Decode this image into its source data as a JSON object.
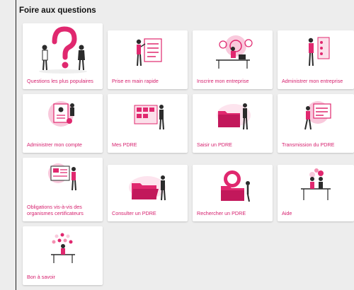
{
  "page": {
    "title": "Foire aux questions"
  },
  "colors": {
    "accent": "#e0286f",
    "pink_light": "#f9c9dc",
    "dark": "#2b2b2b",
    "background": "#ededed"
  },
  "cards": [
    {
      "label": "Questions les plus populaires",
      "icon": "question-mark-people-illustration"
    },
    {
      "label": "Prise en main rapide",
      "icon": "checklist-board-illustration"
    },
    {
      "label": "Inscrire mon entreprise",
      "icon": "desk-registration-illustration"
    },
    {
      "label": "Administrer mon entreprise",
      "icon": "admin-panel-illustration"
    },
    {
      "label": "Administrer mon compte",
      "icon": "account-profile-illustration"
    },
    {
      "label": "Mes PDRE",
      "icon": "document-grid-illustration"
    },
    {
      "label": "Saisir un PDRE",
      "icon": "folder-input-illustration"
    },
    {
      "label": "Transmission du PDRE",
      "icon": "transmission-screen-illustration"
    },
    {
      "label": "Obligations vis-à-vis des organismes certificateurs",
      "icon": "presentation-board-illustration"
    },
    {
      "label": "Consulter un PDRE",
      "icon": "open-folder-illustration"
    },
    {
      "label": "Rechercher un PDRE",
      "icon": "search-folder-illustration"
    },
    {
      "label": "Aide",
      "icon": "help-desk-illustration"
    },
    {
      "label": "Bon à savoir",
      "icon": "tips-tree-illustration"
    }
  ]
}
